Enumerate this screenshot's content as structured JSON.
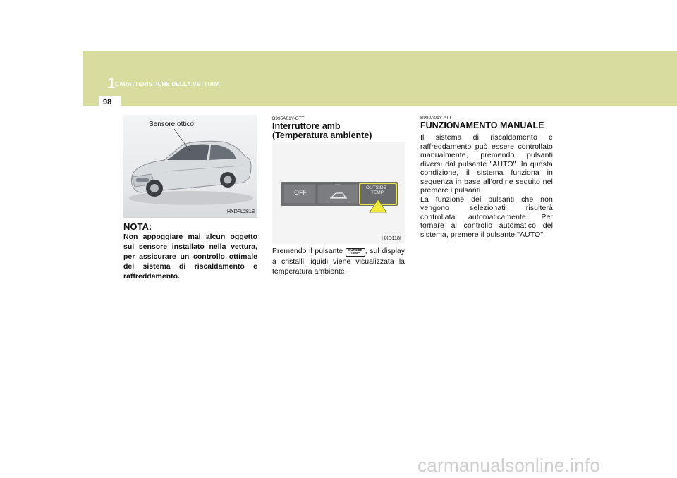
{
  "header": {
    "chapter_number": "1",
    "chapter_title": "CARATTERISTICHE DELLA VETTURA",
    "page_number": "98"
  },
  "colors": {
    "band": "#d8dc9e",
    "button_panel": "#6f7072",
    "button_highlight": "#e6e24a",
    "arrow": "#f0ea3a"
  },
  "column1": {
    "photo_label": "Sensore ottico",
    "photo_code": "HXDFL281S",
    "nota_title": "NOTA:",
    "nota_text": "Non appoggiare mai alcun oggetto sul sensore installato nella vettura, per assicurare un controllo ottimale del sistema di riscaldamento e raffreddamento."
  },
  "column2": {
    "section_code": "B995A01Y-GTT",
    "heading_line1": "Interruttore amb",
    "heading_line2": "(Temperatura ambiente)",
    "panel": {
      "off_label": "OFF",
      "outside_label_1": "OUTSIDE",
      "outside_label_2": "TEMP",
      "dash_label": "---"
    },
    "panel_code": "HXD118I",
    "body_before": "Premendo il pulsante",
    "inline_button_1": "OUTSIDE",
    "inline_button_2": "TEMP",
    "body_after": ", sul display a cristalli liquidi viene visualizzata la temperatura ambiente."
  },
  "column3": {
    "section_code": "B980A01Y-ATT",
    "heading": "FUNZIONAMENTO MANUALE",
    "paragraph1": "Il sistema di riscaldamento e raffreddamento può essere controllato manualmente, premendo pulsanti diversi dal pulsante \"AUTO\". In questa condizione, il sistema funziona in sequenza in base all'ordine seguito nel premere i pulsanti.",
    "paragraph2": "La funzione dei pulsanti che non vengono selezionati risulterà controllata automaticamente. Per tornare al controllo automatico del sistema, premere il pulsante \"AUTO\"."
  },
  "watermark": "carmanualsonline.info"
}
